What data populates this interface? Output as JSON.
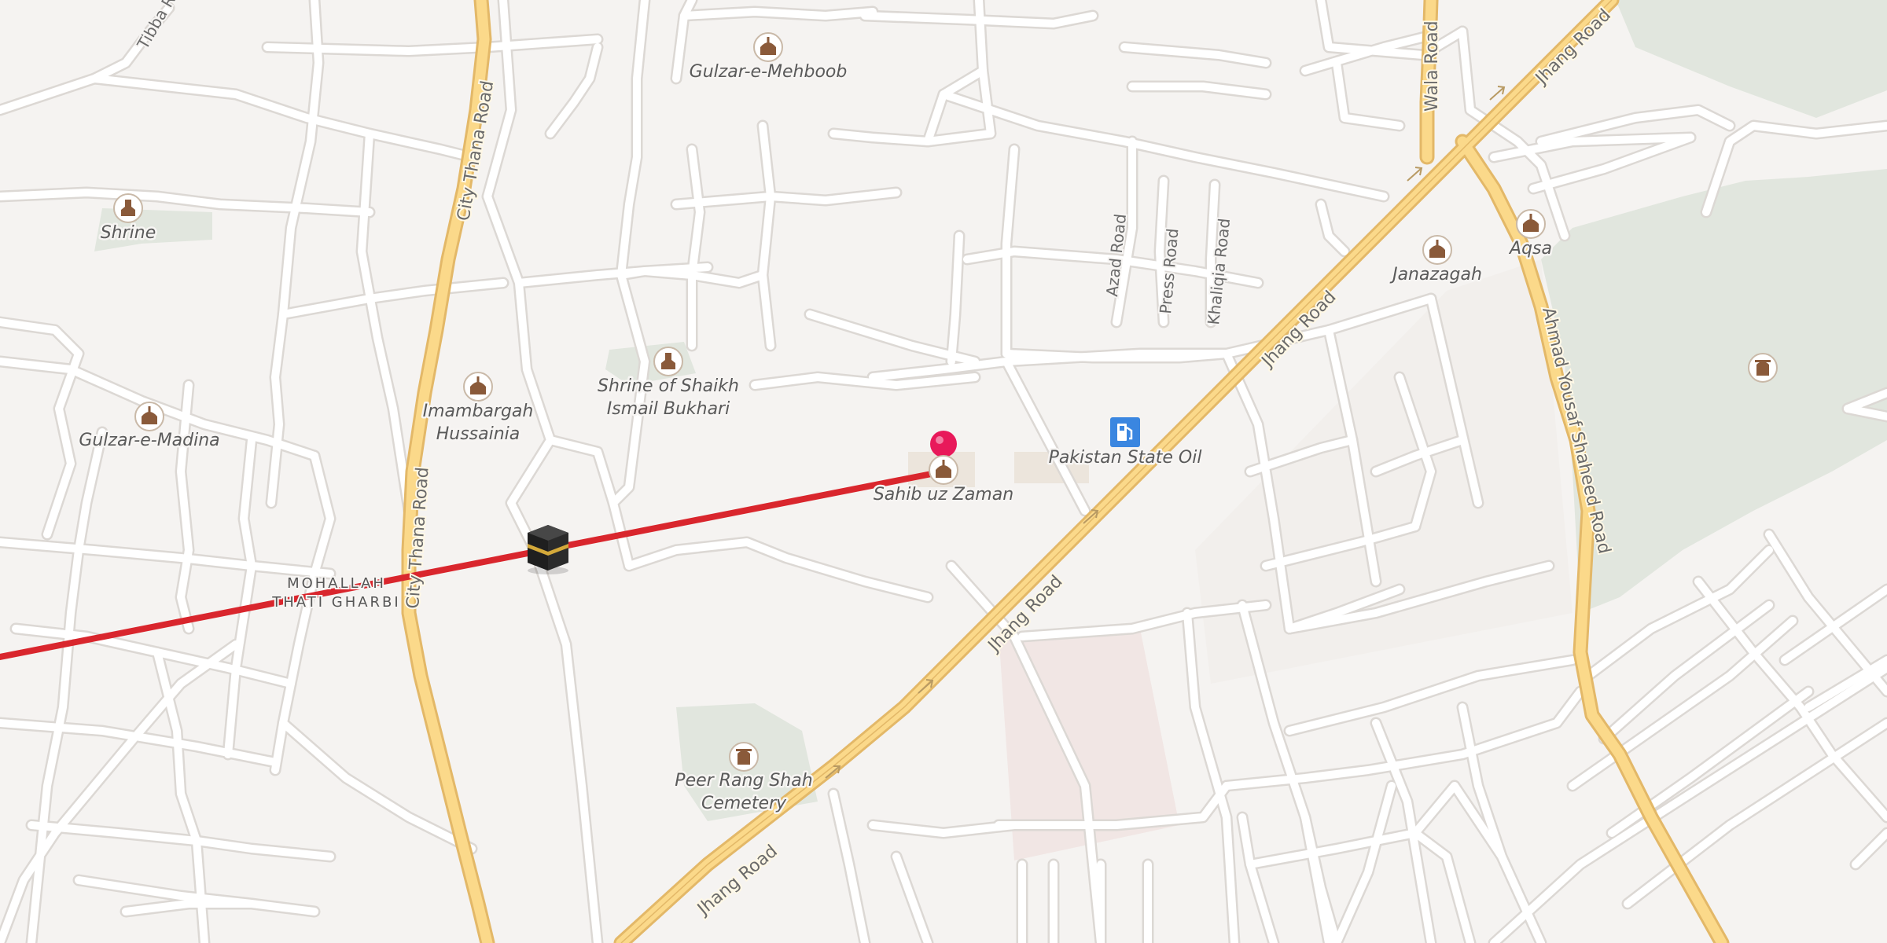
{
  "map": {
    "colors": {
      "background": "#f5f3f1",
      "street": "#ffffff",
      "street_casing": "#dcd8d4",
      "major_road": "#fbd98a",
      "major_road_casing": "#e3b868",
      "park": "#dfe5dc",
      "route": "#d9262d",
      "pin": "#e8195a"
    },
    "route": {
      "from": "Kaaba (Qibla direction)",
      "to": "Sahib uz Zaman"
    },
    "pois": [
      {
        "label": "Gulzar-e-Mehboob",
        "icon": "mosque-icon"
      },
      {
        "label": "Shrine",
        "icon": "shrine-icon"
      },
      {
        "label": "Shrine of Shaikh",
        "label2": "Ismail Bukhari",
        "icon": "shrine-icon"
      },
      {
        "label": "Imambargah",
        "label2": "Hussainia",
        "icon": "mosque-icon"
      },
      {
        "label": "Gulzar-e-Madina",
        "icon": "mosque-icon"
      },
      {
        "label": "Sahib uz Zaman",
        "icon": "mosque-icon"
      },
      {
        "label": "Pakistan State Oil",
        "icon": "fuel-station-icon"
      },
      {
        "label": "Janazagah",
        "icon": "mosque-icon"
      },
      {
        "label": "Aqsa",
        "icon": "mosque-icon"
      },
      {
        "label": "Peer Rang Shah",
        "label2": "Cemetery",
        "icon": "cemetery-icon"
      },
      {
        "label": "",
        "icon": "cemetery-icon"
      }
    ],
    "roads": {
      "city_thana_1": "City Thana Road",
      "city_thana_2": "City Thana Road",
      "jhang_1": "Jhang Road",
      "jhang_2": "Jhang Road",
      "jhang_3": "Jhang Road",
      "jhang_4": "Jhang Road",
      "azad": "Azad Road",
      "press": "Press Road",
      "khaliqia": "Khaliqia Road",
      "wala": "Wala Road",
      "ahmad_yousaf": "Ahmad Yousaf Shaheed Road",
      "tibba": "Tibba R"
    },
    "areas": {
      "mohallah_line1": "MOHALLAH",
      "mohallah_line2": "THATI GHARBI"
    }
  }
}
